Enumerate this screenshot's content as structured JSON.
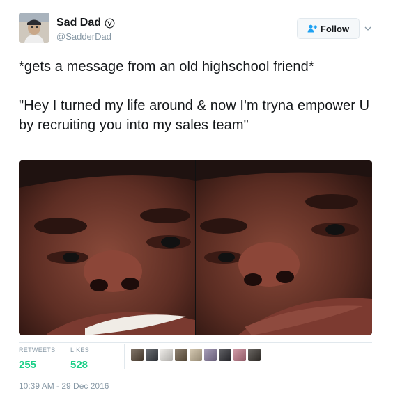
{
  "user": {
    "display_name": "Sad Dad",
    "handle": "@SadderDad",
    "verified_icon": "verified-badge-icon"
  },
  "follow_button": {
    "label": "Follow",
    "icon": "add-user-icon"
  },
  "tweet": {
    "paragraphs": [
      "*gets a message from an old highschool friend*",
      "\"Hey I turned my life around & now I'm tryna empower U by recruiting you into my sales team\""
    ]
  },
  "media": [
    {
      "description_icon": "photo-selfie-smiling"
    },
    {
      "description_icon": "photo-selfie-neutral"
    }
  ],
  "stats": {
    "retweets_label": "RETWEETS",
    "retweets_count": "255",
    "likes_label": "LIKES",
    "likes_count": "528",
    "count_color": "#19cf86"
  },
  "likers": [
    {
      "color": "#5a4a3a"
    },
    {
      "color": "#3b3f46"
    },
    {
      "color": "#e9e6e1"
    },
    {
      "color": "#6b5a44"
    },
    {
      "color": "#c8b89a"
    },
    {
      "color": "#8a7da0"
    },
    {
      "color": "#2f2f35"
    },
    {
      "color": "#c27a8a"
    },
    {
      "color": "#3a3530"
    }
  ],
  "timestamp": "10:39 AM - 29 Dec 2016",
  "colors": {
    "accent": "#1da1f2",
    "muted": "#8899a6",
    "border": "#e1e8ed"
  }
}
